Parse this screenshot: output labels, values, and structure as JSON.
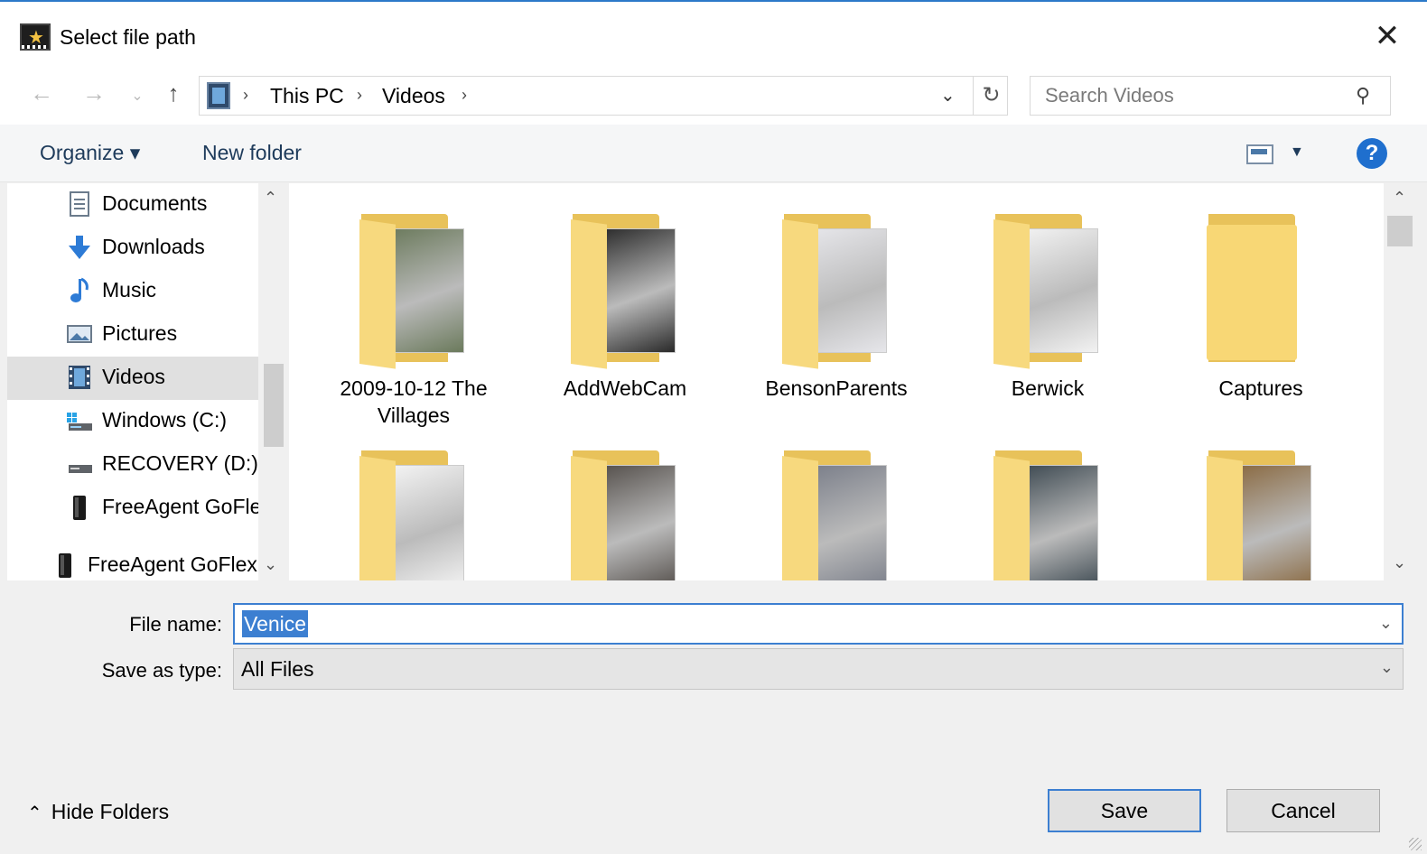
{
  "window": {
    "title": "Select file path",
    "close_label": "✕"
  },
  "nav": {
    "back_icon": "←",
    "forward_icon": "→",
    "recent_icon": "⌄",
    "up_icon": "↑",
    "breadcrumbs": [
      "This PC",
      "Videos"
    ],
    "sep": "›",
    "search_placeholder": "Search Videos"
  },
  "toolbar": {
    "organize": "Organize ▾",
    "new_folder": "New folder",
    "help": "?"
  },
  "sidebar": {
    "items": [
      {
        "label": "Documents",
        "icon": "documents-icon"
      },
      {
        "label": "Downloads",
        "icon": "downloads-icon"
      },
      {
        "label": "Music",
        "icon": "music-icon"
      },
      {
        "label": "Pictures",
        "icon": "pictures-icon"
      },
      {
        "label": "Videos",
        "icon": "videos-icon",
        "selected": true
      },
      {
        "label": "Windows (C:)",
        "icon": "drive-c-icon"
      },
      {
        "label": "RECOVERY (D:)",
        "icon": "drive-d-icon"
      },
      {
        "label": "FreeAgent GoFle",
        "icon": "external-drive-icon"
      },
      {
        "label": "FreeAgent GoFlex",
        "icon": "external-drive-icon"
      }
    ]
  },
  "folders": [
    {
      "name": "2009-10-12 The\nVillages",
      "thumb": "#6b7a5c"
    },
    {
      "name": "AddWebCam",
      "thumb": "#2a2a2a"
    },
    {
      "name": "BensonParents",
      "thumb": "#e6e6ea"
    },
    {
      "name": "Berwick",
      "thumb": "#f2f2f2"
    },
    {
      "name": "Captures",
      "thumb": null
    },
    {
      "name": "",
      "thumb": "#f4f4f4"
    },
    {
      "name": "",
      "thumb": "#55504c"
    },
    {
      "name": "",
      "thumb": "#7b7f8a"
    },
    {
      "name": "",
      "thumb": "#3e4a52"
    },
    {
      "name": "",
      "thumb": "#8a6a42"
    }
  ],
  "form": {
    "file_name_label": "File name:",
    "file_name_value": "Venice",
    "save_type_label": "Save as type:",
    "save_type_value": "All Files"
  },
  "footer": {
    "hide_folders": "Hide Folders",
    "save": "Save",
    "cancel": "Cancel"
  },
  "colors": {
    "accent": "#3c7fd1",
    "folder": "#f8d775",
    "selected_bg": "#e0e0e0"
  }
}
